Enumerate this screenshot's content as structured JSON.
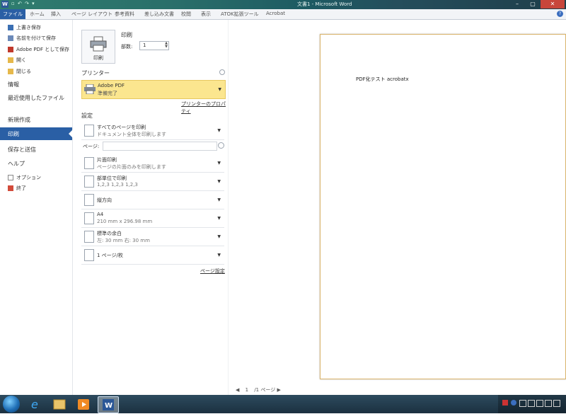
{
  "window": {
    "title": "文書1 - Microsoft Word",
    "app_icon": "W",
    "quick_access": "▫ ↶ ↷ ▾"
  },
  "ribbon": {
    "file_tab": "ファイル",
    "tabs": [
      "ホーム",
      "挿入",
      "ページ レイアウト",
      "参考資料",
      "差し込み文書",
      "校閲",
      "表示",
      "ATOK拡張ツール",
      "Acrobat"
    ]
  },
  "backstage": {
    "commands": [
      {
        "label": "上書き保存",
        "icon": "save-icon"
      },
      {
        "label": "名前を付けて保存",
        "icon": "save-as-icon"
      },
      {
        "label": "Adobe PDF として保存",
        "icon": "pdf-icon"
      },
      {
        "label": "開く",
        "icon": "open-folder-icon"
      },
      {
        "label": "閉じる",
        "icon": "close-folder-icon"
      }
    ],
    "sections": {
      "info": "情報",
      "recent": "最近使用したファイル",
      "new": "新規作成",
      "print": "印刷",
      "save_send": "保存と送信",
      "help": "ヘルプ"
    },
    "bottom_commands": [
      {
        "label": "オプション",
        "icon": "options-icon"
      },
      {
        "label": "終了",
        "icon": "exit-icon"
      }
    ]
  },
  "print_panel": {
    "print_button": "印刷",
    "heading": "印刷",
    "copies_label": "部数:",
    "copies_value": "1",
    "printer_heading": "プリンター",
    "printer_name": "Adobe PDF",
    "printer_status": "準備完了",
    "printer_properties_link": "プリンターのプロパティ",
    "settings_heading": "設定",
    "settings": [
      {
        "line1": "すべてのページを印刷",
        "line2": "ドキュメント全体を印刷します"
      },
      {
        "line1": "片面印刷",
        "line2": "ページの片面のみを印刷します"
      },
      {
        "line1": "部単位で印刷",
        "line2": "1,2,3    1,2,3    1,2,3"
      },
      {
        "line1": "縦方向",
        "line2": ""
      },
      {
        "line1": "A4",
        "line2": "210 mm x 296.98 mm"
      },
      {
        "line1": "標準の余白",
        "line2": "左:  30 mm    右:  30 mm"
      },
      {
        "line1": "1 ページ/枚",
        "line2": ""
      }
    ],
    "pages_label": "ページ:",
    "pages_value": "",
    "page_setup_link": "ページ設定"
  },
  "preview": {
    "page_text": "PDF化テスト acrobatx",
    "current_page": "1",
    "total_pages": "/1 ページ"
  },
  "colors": {
    "accent": "#2a5fa5",
    "printer_highlight": "#fbe68f",
    "close_button": "#c8463b"
  }
}
